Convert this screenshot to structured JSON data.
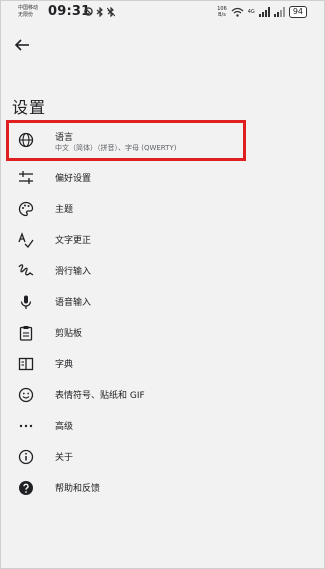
{
  "status_bar": {
    "carrier_line1": "中国移动",
    "carrier_line2": "无限份",
    "time": "09:31",
    "net_speed_value": "106",
    "net_speed_unit": "B/s",
    "signal_label": "4G",
    "battery": "94"
  },
  "header": {
    "back_icon": "arrow-left-icon",
    "title": "设置"
  },
  "settings": [
    {
      "label": "语言",
      "sublabel": "中文（简体）（拼音）、字母 (QWERTY)",
      "icon": "globe-icon"
    },
    {
      "label": "偏好设置",
      "icon": "sliders-icon"
    },
    {
      "label": "主题",
      "icon": "palette-icon"
    },
    {
      "label": "文字更正",
      "icon": "spellcheck-icon"
    },
    {
      "label": "滑行输入",
      "icon": "gesture-icon"
    },
    {
      "label": "语音输入",
      "icon": "microphone-icon"
    },
    {
      "label": "剪贴板",
      "icon": "clipboard-icon"
    },
    {
      "label": "字典",
      "icon": "dictionary-icon"
    },
    {
      "label": "表情符号、贴纸和 GIF",
      "icon": "emoji-icon"
    },
    {
      "label": "高级",
      "icon": "more-dots-icon"
    },
    {
      "label": "关于",
      "icon": "info-icon"
    },
    {
      "label": "帮助和反馈",
      "icon": "help-icon"
    }
  ],
  "colors": {
    "highlight": "#e02020",
    "background": "#f2f2f2"
  }
}
